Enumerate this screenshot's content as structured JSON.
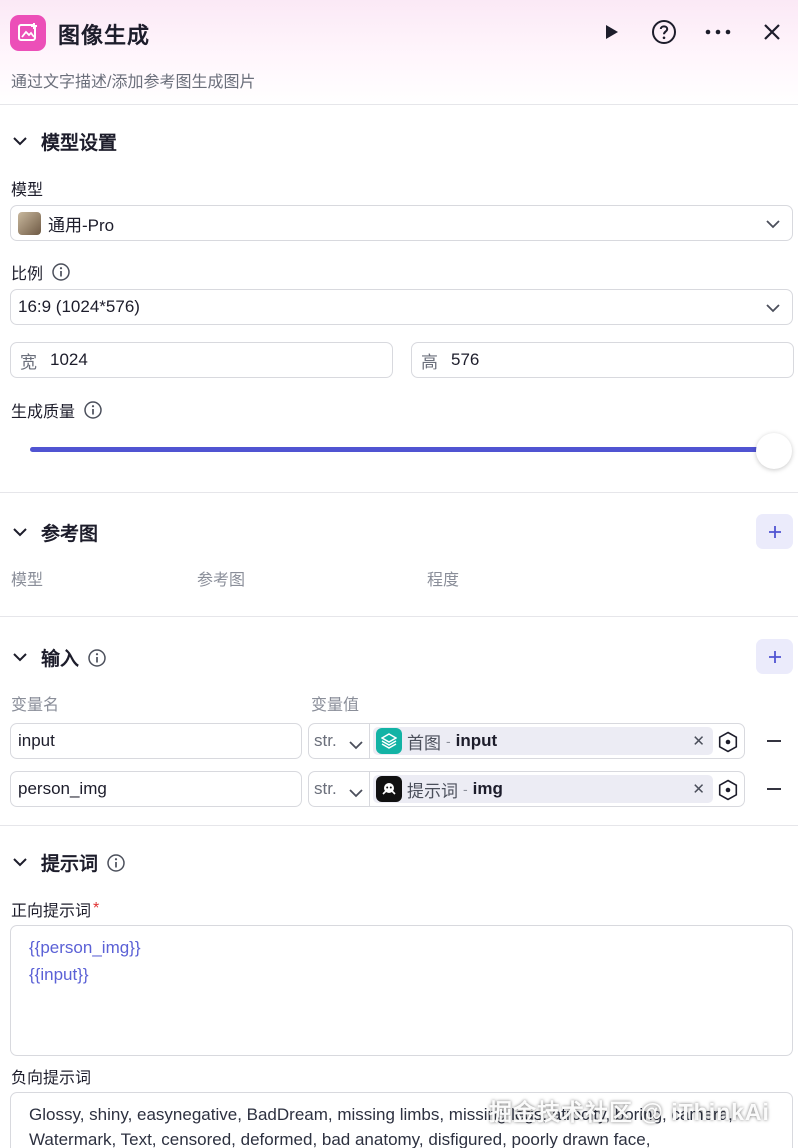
{
  "header": {
    "title": "图像生成",
    "subtitle": "通过文字描述/添加参考图生成图片",
    "icon": "image-generate-icon",
    "accent": "#ec4fb8",
    "actions": [
      "play-icon",
      "help-icon",
      "more-icon",
      "close-icon"
    ]
  },
  "model_settings": {
    "title": "模型设置",
    "model_label": "模型",
    "model_value": "通用-Pro",
    "ratio_label": "比例",
    "ratio_value": "16:9 (1024*576)",
    "width_label": "宽",
    "width_value": "1024",
    "height_label": "高",
    "height_value": "576",
    "quality_label": "生成质量",
    "quality_level": 1.0,
    "slider_color": "#5054d2"
  },
  "reference": {
    "title": "参考图",
    "columns": [
      "模型",
      "参考图",
      "程度"
    ]
  },
  "inputs": {
    "title": "输入",
    "col_name": "变量名",
    "col_value": "变量值",
    "rows": [
      {
        "name": "input",
        "type": "str.",
        "ref_node": "首图",
        "ref_sep": "-",
        "ref_field": "input",
        "icon_color": "#13b3a5"
      },
      {
        "name": "person_img",
        "type": "str.",
        "ref_node": "提示词",
        "ref_sep": "-",
        "ref_field": "img",
        "icon_color": "#111111"
      }
    ]
  },
  "prompt": {
    "title": "提示词",
    "positive_label": "正向提示词",
    "required_mark": "*",
    "positive_lines": [
      "{{person_img}}",
      "{{input}}"
    ],
    "negative_label": "负向提示词",
    "negative_text": "Glossy, shiny, easynegative, BadDream, missing limbs, missing legs, atrocity, boring, camera, Watermark, Text, censored, deformed, bad anatomy, disfigured, poorly drawn face,"
  },
  "watermark": "掘金技术社区 @ iThinkAi"
}
